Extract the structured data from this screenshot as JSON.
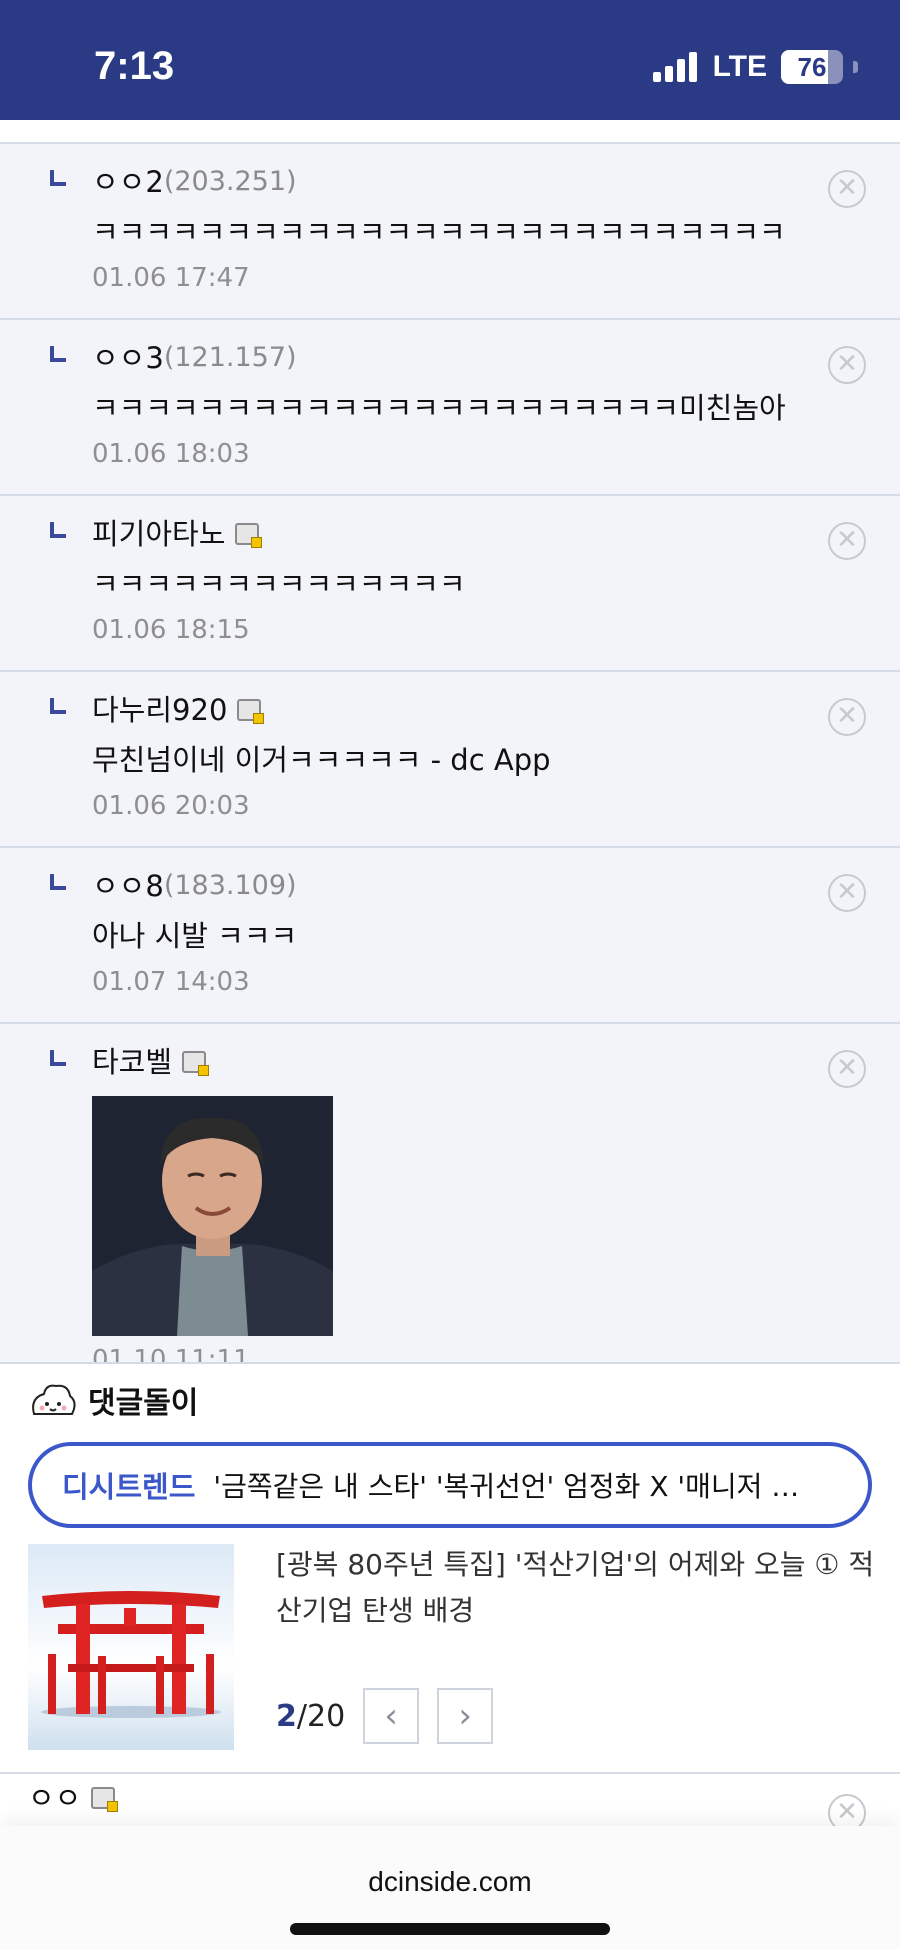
{
  "status_bar": {
    "time": "7:13",
    "network": "LTE",
    "battery": "76",
    "battery_level": 0.76
  },
  "comments": [
    {
      "author": "ㅇㅇ2",
      "ip": "(203.251)",
      "has_gallog_icon": false,
      "text": "ㅋㅋㅋㅋㅋㅋㅋㅋㅋㅋㅋㅋㅋㅋㅋㅋㅋㅋㅋㅋㅋㅋㅋㅋㅋㅋ",
      "date": "01.06 17:47"
    },
    {
      "author": "ㅇㅇ3",
      "ip": "(121.157)",
      "has_gallog_icon": false,
      "text": "ㅋㅋㅋㅋㅋㅋㅋㅋㅋㅋㅋㅋㅋㅋㅋㅋㅋㅋㅋㅋㅋㅋ미친놈아",
      "date": "01.06 18:03"
    },
    {
      "author": "피기아타노",
      "ip": "",
      "has_gallog_icon": true,
      "text": "ㅋㅋㅋㅋㅋㅋㅋㅋㅋㅋㅋㅋㅋㅋ",
      "date": "01.06 18:15"
    },
    {
      "author": "다누리920",
      "ip": "",
      "has_gallog_icon": true,
      "text": "무친넘이네 이거ㅋㅋㅋㅋㅋ - dc App",
      "date": "01.06 20:03"
    },
    {
      "author": "ㅇㅇ8",
      "ip": "(183.109)",
      "has_gallog_icon": false,
      "text": "아나 시발 ㅋㅋㅋ",
      "date": "01.07 14:03"
    },
    {
      "author": "타코벨",
      "ip": "",
      "has_gallog_icon": true,
      "text": "",
      "has_image": true,
      "date": "01.10 11:11"
    }
  ],
  "reply_bot": {
    "title": "댓글돌이",
    "trend_label": "디시트렌드",
    "trend_text": "'금쪽같은 내 스타' '복귀선언' 엄정화 X '매니저 …",
    "article_title": "[광복 80주년 특집] '적산기업'의 어제와 오늘 ① 적산기업 탄생 배경",
    "page_current": "2",
    "page_total": "/20",
    "prev_symbol": "‹",
    "next_symbol": "›"
  },
  "next_comment": {
    "author": "ㅇㅇ"
  },
  "browser": {
    "url": "dcinside.com"
  },
  "icons": {
    "delete": "close-circle-icon",
    "reply": "reply-arrow-icon",
    "gallog": "gallog-icon"
  }
}
